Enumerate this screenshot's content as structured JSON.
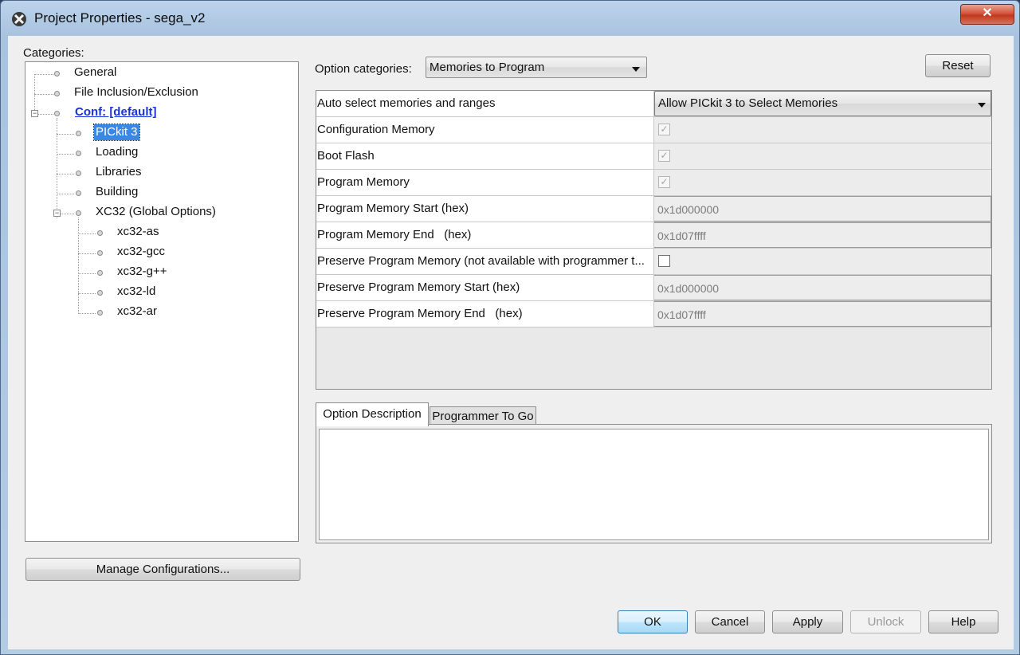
{
  "window": {
    "title": "Project Properties - sega_v2",
    "close_glyph": "✕"
  },
  "categories": {
    "label": "Categories:",
    "items": [
      {
        "label": "General"
      },
      {
        "label": "File Inclusion/Exclusion"
      },
      {
        "label": "Conf: [default]"
      },
      {
        "label": "PICkit 3"
      },
      {
        "label": "Loading"
      },
      {
        "label": "Libraries"
      },
      {
        "label": "Building"
      },
      {
        "label": "XC32 (Global Options)"
      },
      {
        "label": "xc32-as"
      },
      {
        "label": "xc32-gcc"
      },
      {
        "label": "xc32-g++"
      },
      {
        "label": "xc32-ld"
      },
      {
        "label": "xc32-ar"
      }
    ],
    "expander_glyph": "−"
  },
  "option_categories": {
    "label": "Option categories:",
    "selected": "Memories to Program"
  },
  "reset_label": "Reset",
  "properties": {
    "rows": [
      {
        "name": "Auto select memories and ranges",
        "value": "Allow PICkit 3 to Select Memories"
      },
      {
        "name": "Configuration Memory",
        "check": "✓"
      },
      {
        "name": "Boot Flash",
        "check": "✓"
      },
      {
        "name": "Program Memory",
        "check": "✓"
      },
      {
        "name": "Program Memory Start (hex)",
        "value": "0x1d000000"
      },
      {
        "name": "Program Memory End   (hex)",
        "value": "0x1d07ffff"
      },
      {
        "name": "Preserve Program Memory (not available with programmer t...",
        "check": ""
      },
      {
        "name": "Preserve Program Memory Start (hex)",
        "value": "0x1d000000"
      },
      {
        "name": "Preserve Program Memory End   (hex)",
        "value": "0x1d07ffff"
      }
    ]
  },
  "tabs": {
    "option_description": "Option Description",
    "programmer_to_go": "Programmer To Go"
  },
  "manage_configurations_label": "Manage Configurations...",
  "footer": {
    "ok": "OK",
    "cancel": "Cancel",
    "apply": "Apply",
    "unlock": "Unlock",
    "help": "Help"
  },
  "colors": {
    "titlebar": "#b4cbe4",
    "selection": "#3a88e6",
    "conf_link": "#1a33d6",
    "close_button": "#c0391f"
  }
}
